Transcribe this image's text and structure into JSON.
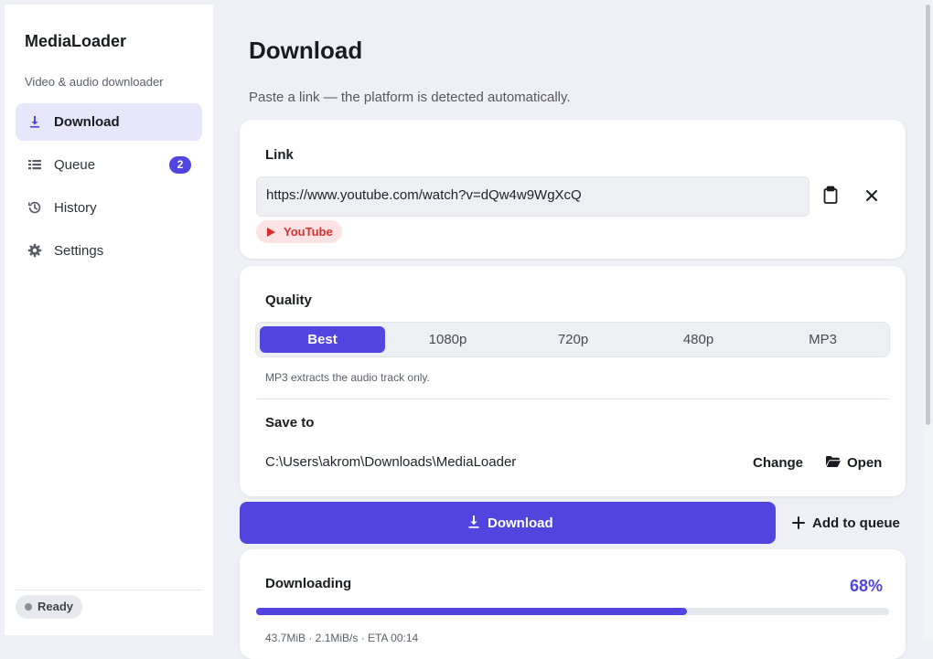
{
  "app": {
    "name": "MediaLoader",
    "tagline": "Video & audio downloader"
  },
  "nav": {
    "items": [
      {
        "label": "Download",
        "icon": "download-icon",
        "active": true
      },
      {
        "label": "Queue",
        "icon": "list-icon",
        "badge": "2"
      },
      {
        "label": "History",
        "icon": "history-icon"
      },
      {
        "label": "Settings",
        "icon": "gear-icon"
      }
    ]
  },
  "status": {
    "label": "Ready"
  },
  "page": {
    "title": "Download",
    "subtitle": "Paste a link — the platform is detected automatically."
  },
  "link": {
    "label": "Link",
    "value": "https://www.youtube.com/watch?v=dQw4w9WgXcQ",
    "platform": "YouTube",
    "icons": {
      "paste": "clipboard-icon",
      "clear": "close-icon"
    }
  },
  "quality": {
    "label": "Quality",
    "options": [
      "Best",
      "1080p",
      "720p",
      "480p",
      "MP3"
    ],
    "selected": "Best",
    "hint": "MP3 extracts the audio track only."
  },
  "save": {
    "label": "Save to",
    "path": "C:\\Users\\akrom\\Downloads\\MediaLoader",
    "change_label": "Change",
    "open_label": "Open"
  },
  "actions": {
    "download_label": "Download",
    "queue_label": "Add to queue"
  },
  "progress": {
    "label": "Downloading",
    "percent_label": "68%",
    "fraction": 0.68,
    "stats": "43.7MiB · 2.1MiB/s · ETA 00:14"
  },
  "colors": {
    "accent": "#5145e0",
    "platform": "#d63031",
    "background": "#eef0f5"
  }
}
